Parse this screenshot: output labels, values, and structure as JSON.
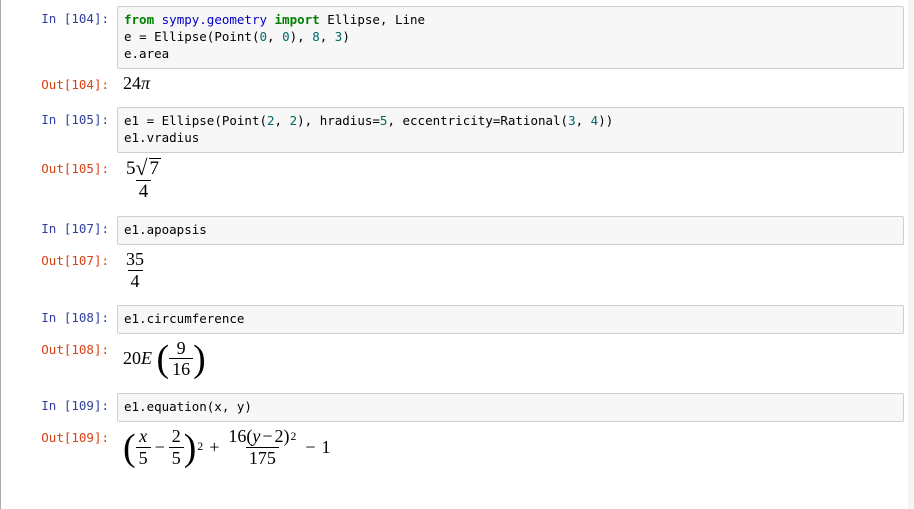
{
  "cells": [
    {
      "id": "104",
      "in_prompt": "In [104]:",
      "code_tokens": [
        {
          "t": "from ",
          "c": "kw"
        },
        {
          "t": "sympy.geometry",
          "c": "nm"
        },
        {
          "t": " "
        },
        {
          "t": "import ",
          "c": "kw"
        },
        {
          "t": "Ellipse, Line"
        },
        {
          "t": "\n"
        },
        {
          "t": "e "
        },
        {
          "t": "="
        },
        {
          "t": " Ellipse(Point("
        },
        {
          "t": "0",
          "c": "num"
        },
        {
          "t": ", "
        },
        {
          "t": "0",
          "c": "num"
        },
        {
          "t": "), "
        },
        {
          "t": "8",
          "c": "num"
        },
        {
          "t": ", "
        },
        {
          "t": "3",
          "c": "num"
        },
        {
          "t": ")"
        },
        {
          "t": "\n"
        },
        {
          "t": "e.area"
        }
      ],
      "out_prompt": "Out[104]:",
      "out_kind": "simple",
      "out": {
        "coef": "24",
        "sym": "π"
      }
    },
    {
      "id": "105",
      "in_prompt": "In [105]:",
      "code_tokens": [
        {
          "t": "e1 "
        },
        {
          "t": "="
        },
        {
          "t": " Ellipse(Point("
        },
        {
          "t": "2",
          "c": "num"
        },
        {
          "t": ", "
        },
        {
          "t": "2",
          "c": "num"
        },
        {
          "t": "), hradius"
        },
        {
          "t": "="
        },
        {
          "t": "5",
          "c": "num"
        },
        {
          "t": ", eccentricity"
        },
        {
          "t": "="
        },
        {
          "t": "Rational("
        },
        {
          "t": "3",
          "c": "num"
        },
        {
          "t": ", "
        },
        {
          "t": "4",
          "c": "num"
        },
        {
          "t": "))"
        },
        {
          "t": "\n"
        },
        {
          "t": "e1.vradius"
        }
      ],
      "out_prompt": "Out[105]:",
      "out_kind": "frac_sqrt",
      "out": {
        "coef": "5",
        "radicand": "7",
        "den": "4"
      }
    },
    {
      "id": "107",
      "in_prompt": "In [107]:",
      "code_tokens": [
        {
          "t": "e1.apoapsis"
        }
      ],
      "out_prompt": "Out[107]:",
      "out_kind": "frac",
      "out": {
        "num": "35",
        "den": "4"
      }
    },
    {
      "id": "108",
      "in_prompt": "In [108]:",
      "code_tokens": [
        {
          "t": "e1.circumference"
        }
      ],
      "out_prompt": "Out[108]:",
      "out_kind": "elliptic",
      "out": {
        "coef": "20",
        "fn": "E",
        "arg_num": "9",
        "arg_den": "16"
      }
    },
    {
      "id": "109",
      "in_prompt": "In [109]:",
      "code_tokens": [
        {
          "t": "e1.equation(x, y)"
        }
      ],
      "out_prompt": "Out[109]:",
      "out_kind": "equation",
      "out": {
        "t1_varnum": "x",
        "t1_vardenom": "5",
        "t1_cnum": "2",
        "t1_cdenom": "5",
        "t1_pow": "2",
        "plus": "+",
        "t2_coef": "16",
        "t2_var": "y",
        "t2_shift": "2",
        "t2_pow": "2",
        "t2_den": "175",
        "minus": "−",
        "tail": "1"
      }
    }
  ]
}
